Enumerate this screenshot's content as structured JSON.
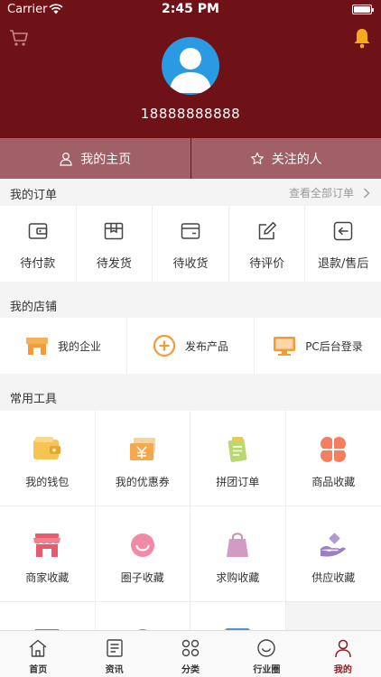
{
  "status": {
    "carrier": "Carrier",
    "time": "2:45 PM"
  },
  "profile": {
    "phone": "18888888888"
  },
  "quick": {
    "home": "我的主页",
    "following": "关注的人"
  },
  "orders": {
    "title": "我的订单",
    "view_all": "查看全部订单",
    "items": [
      {
        "label": "待付款",
        "icon": "wallet-icon"
      },
      {
        "label": "待发货",
        "icon": "package-icon"
      },
      {
        "label": "待收货",
        "icon": "inbox-icon"
      },
      {
        "label": "待评价",
        "icon": "edit-icon"
      },
      {
        "label": "退款/售后",
        "icon": "return-icon"
      }
    ]
  },
  "shop": {
    "title": "我的店铺",
    "items": [
      {
        "label": "我的企业",
        "icon": "store-icon"
      },
      {
        "label": "发布产品",
        "icon": "plus-circle-icon"
      },
      {
        "label": "PC后台登录",
        "icon": "monitor-icon"
      }
    ]
  },
  "tools": {
    "title": "常用工具",
    "items": [
      {
        "label": "我的钱包",
        "icon": "wallet-icon"
      },
      {
        "label": "我的优惠券",
        "icon": "coupon-icon"
      },
      {
        "label": "拼团订单",
        "icon": "group-order-icon"
      },
      {
        "label": "商品收藏",
        "icon": "clover-icon"
      },
      {
        "label": "商家收藏",
        "icon": "shop-icon"
      },
      {
        "label": "圈子收藏",
        "icon": "smile-icon"
      },
      {
        "label": "求购收藏",
        "icon": "shopping-bag-icon"
      },
      {
        "label": "供应收藏",
        "icon": "hand-supply-icon"
      }
    ]
  },
  "tabs": [
    {
      "label": "首页",
      "icon": "home-icon"
    },
    {
      "label": "资讯",
      "icon": "news-icon"
    },
    {
      "label": "分类",
      "icon": "category-icon"
    },
    {
      "label": "行业圈",
      "icon": "circle-icon"
    },
    {
      "label": "我的",
      "icon": "user-icon",
      "active": true
    }
  ],
  "colors": {
    "header": "#6e1218",
    "quickbar": "#a06066",
    "accent": "#8b1a22",
    "orange": "#f29b38",
    "avatar": "#2a9be3"
  }
}
